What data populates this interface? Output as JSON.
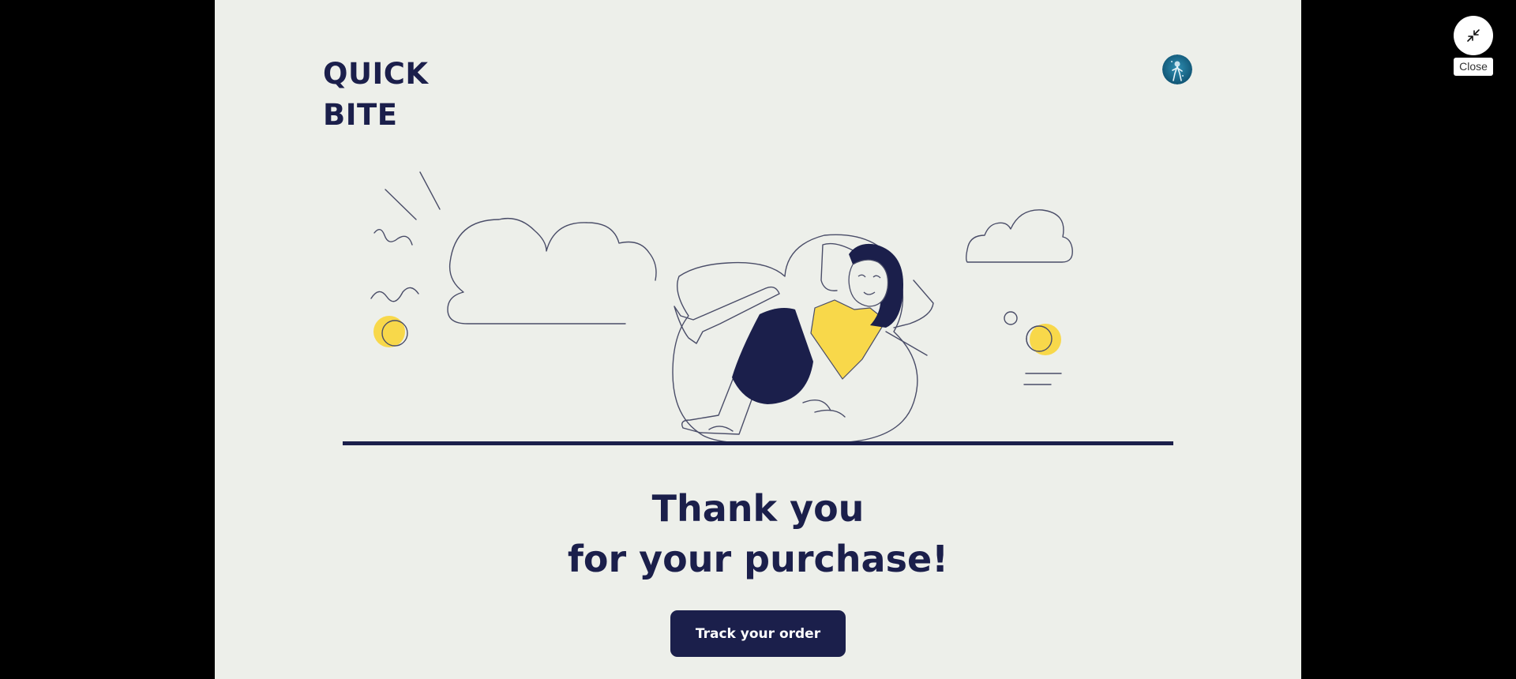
{
  "brand": {
    "line1": "QUICK",
    "line2": "BITE"
  },
  "header": {
    "avatar_icon": "user-avatar"
  },
  "main": {
    "title_line1": "Thank you",
    "title_line2": "for your purchase!",
    "track_button_label": "Track your order",
    "illustration_icon": "relaxing-woman-on-beanbag"
  },
  "viewer": {
    "close_icon": "collapse-arrows-icon",
    "close_tooltip": "Close"
  },
  "colors": {
    "navy": "#1b1f4b",
    "background": "#edefea",
    "accent_yellow": "#f8d84a",
    "outer": "#000000"
  }
}
